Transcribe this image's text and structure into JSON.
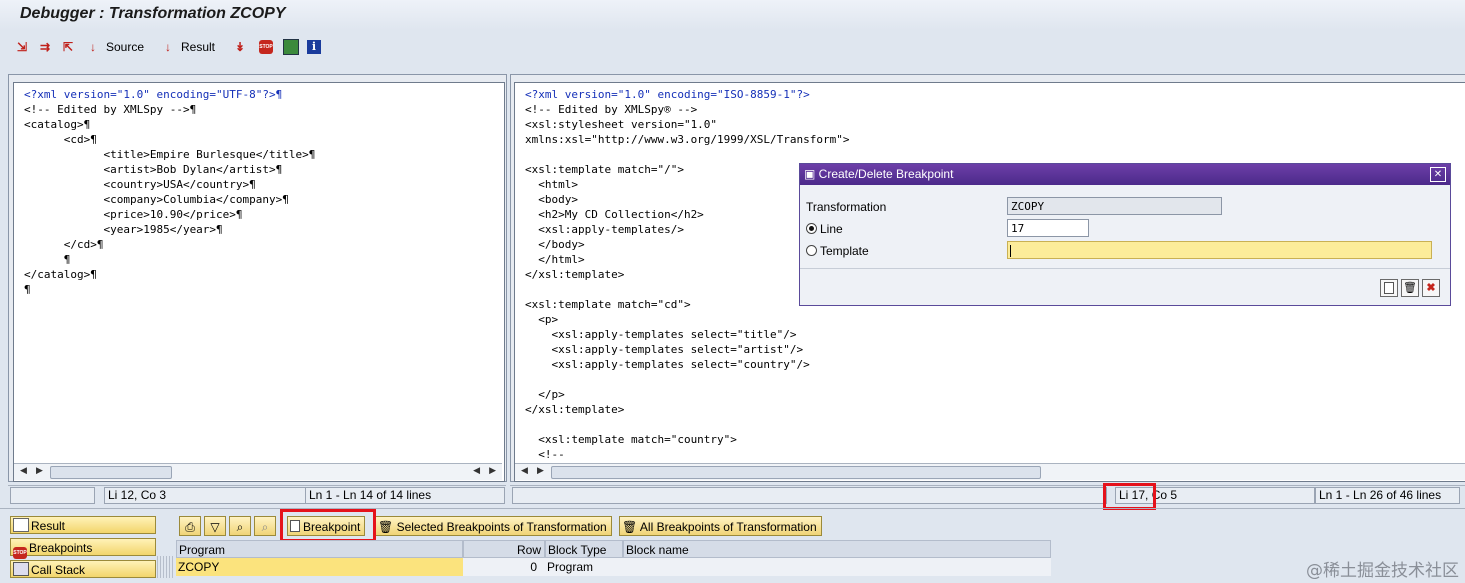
{
  "window": {
    "title": "Debugger : Transformation ZCOPY"
  },
  "toolbar": {
    "icons": [
      "step-into-icon",
      "step-over-icon",
      "step-return-icon"
    ],
    "source_label": "Source",
    "result_label": "Result",
    "extra_icons": [
      "continue-icon",
      "stop-icon",
      "display-icon",
      "info-icon"
    ]
  },
  "left_pane": {
    "lines": [
      "<?xml version=\"1.0\" encoding=\"UTF-8\"?>¶",
      "<!-- Edited by XMLSpy -->¶",
      "<catalog>¶",
      "\t<cd>¶",
      "\t\t<title>Empire Burlesque</title>¶",
      "\t\t<artist>Bob Dylan</artist>¶",
      "\t\t<country>USA</country>¶",
      "\t\t<company>Columbia</company>¶",
      "\t\t<price>10.90</price>¶",
      "\t\t<year>1985</year>¶",
      "\t</cd>¶",
      "\t¶",
      "</catalog>¶",
      "¶"
    ],
    "status_pos": "Li 12, Co 3",
    "status_lines": "Ln 1 - Ln 14 of 14 lines"
  },
  "right_pane": {
    "lines": [
      "<?xml version=\"1.0\" encoding=\"ISO-8859-1\"?>",
      "<!-- Edited by XMLSpy® -->",
      "<xsl:stylesheet version=\"1.0\"",
      "xmlns:xsl=\"http://www.w3.org/1999/XSL/Transform\">",
      "",
      "<xsl:template match=\"/\">",
      "  <html>",
      "  <body>",
      "  <h2>My CD Collection</h2>",
      "  <xsl:apply-templates/>",
      "  </body>",
      "  </html>",
      "</xsl:template>",
      "",
      "<xsl:template match=\"cd\">",
      "  <p>",
      "    <xsl:apply-templates select=\"title\"/>",
      "    <xsl:apply-templates select=\"artist\"/>",
      "    <xsl:apply-templates select=\"country\"/>",
      "",
      "  </p>",
      "</xsl:template>",
      "",
      "  <xsl:template match=\"country\">",
      "  <!--"
    ],
    "status_pos": "Li 17, Co 5",
    "status_lines": "Ln 1 - Ln 26 of 46 lines"
  },
  "dialog": {
    "title": "Create/Delete Breakpoint",
    "transformation_label": "Transformation",
    "transformation_value": "ZCOPY",
    "line_label": "Line",
    "line_value": "17",
    "template_label": "Template",
    "template_value": "",
    "selected_option": "Line"
  },
  "nav": {
    "result": "Result",
    "breakpoints": "Breakpoints",
    "call_stack": "Call Stack"
  },
  "bp_toolbar": {
    "breakpoint": "Breakpoint",
    "selected": "Selected Breakpoints of Transformation",
    "all": "All Breakpoints of Transformation"
  },
  "table": {
    "headers": [
      "Program",
      "Row",
      "Block Type",
      "Block name"
    ],
    "rows": [
      {
        "program": "ZCOPY",
        "row": "0",
        "block_type": "Program",
        "block_name": ""
      }
    ]
  },
  "colors": {
    "accent_purple": "#5b3597",
    "highlight_red": "#e5121b",
    "yellow_button": "#f2d56c"
  },
  "watermark": "@稀土掘金技术社区"
}
